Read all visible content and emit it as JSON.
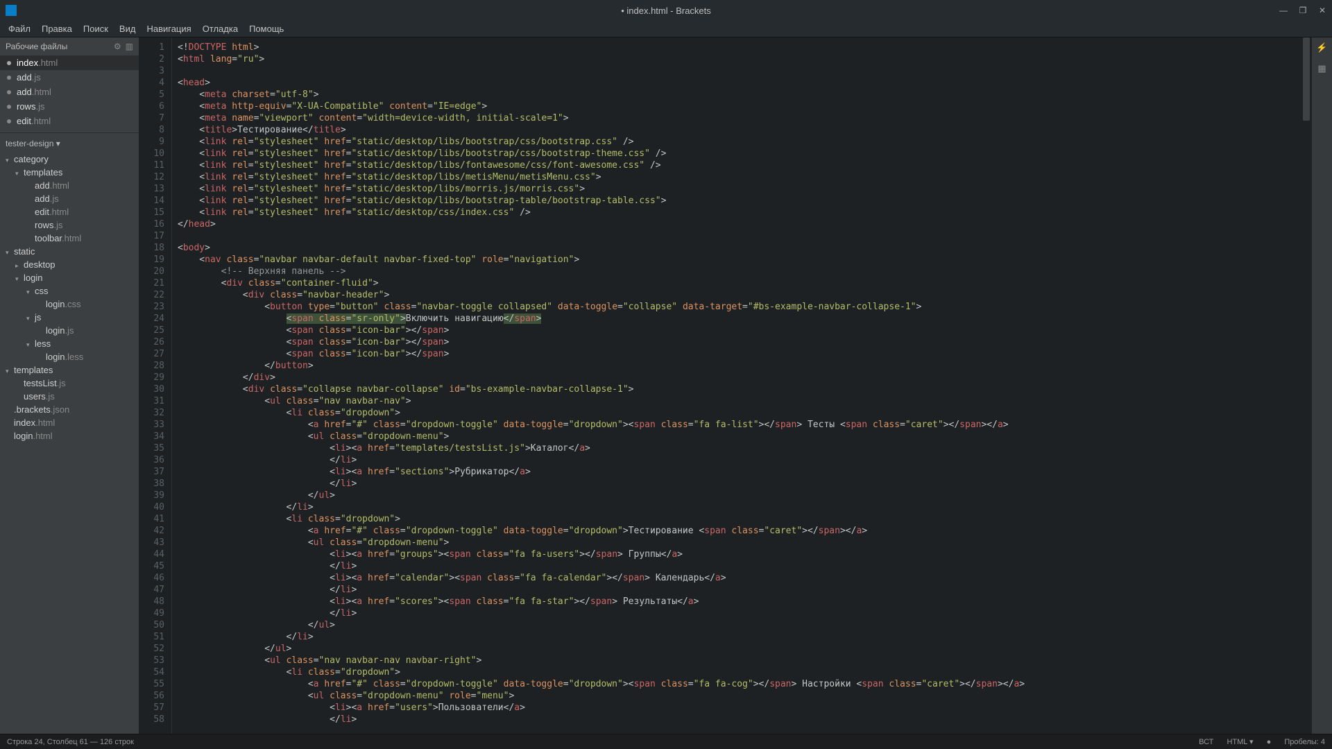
{
  "title": "• index.html - Brackets",
  "menu": [
    "Файл",
    "Правка",
    "Поиск",
    "Вид",
    "Навигация",
    "Отладка",
    "Помощь"
  ],
  "sidebar": {
    "working_files_label": "Рабочие файлы",
    "working_files": [
      {
        "name": "index",
        "ext": ".html",
        "active": true
      },
      {
        "name": "add",
        "ext": ".js"
      },
      {
        "name": "add",
        "ext": ".html"
      },
      {
        "name": "rows",
        "ext": ".js"
      },
      {
        "name": "edit",
        "ext": ".html"
      }
    ],
    "project": "tester-design ▾",
    "tree": [
      {
        "l": 0,
        "arrow": "▾",
        "text": "category"
      },
      {
        "l": 1,
        "arrow": "▾",
        "text": "templates"
      },
      {
        "l": 2,
        "text": "add",
        "ext": ".html"
      },
      {
        "l": 2,
        "text": "add",
        "ext": ".js"
      },
      {
        "l": 2,
        "text": "edit",
        "ext": ".html"
      },
      {
        "l": 2,
        "text": "rows",
        "ext": ".js"
      },
      {
        "l": 2,
        "text": "toolbar",
        "ext": ".html"
      },
      {
        "l": 0,
        "arrow": "▾",
        "text": "static"
      },
      {
        "l": 1,
        "arrow": "▸",
        "text": "desktop"
      },
      {
        "l": 1,
        "arrow": "▾",
        "text": "login"
      },
      {
        "l": 2,
        "arrow": "▾",
        "text": "css"
      },
      {
        "l": 3,
        "text": "login",
        "ext": ".css"
      },
      {
        "l": 2,
        "arrow": "▾",
        "text": "js"
      },
      {
        "l": 3,
        "text": "login",
        "ext": ".js"
      },
      {
        "l": 2,
        "arrow": "▾",
        "text": "less"
      },
      {
        "l": 3,
        "text": "login",
        "ext": ".less"
      },
      {
        "l": 0,
        "arrow": "▾",
        "text": "templates"
      },
      {
        "l": 1,
        "text": "testsList",
        "ext": ".js"
      },
      {
        "l": 1,
        "text": "users",
        "ext": ".js"
      },
      {
        "l": 0,
        "text": ".brackets",
        "ext": ".json"
      },
      {
        "l": 0,
        "text": "index",
        "ext": ".html"
      },
      {
        "l": 0,
        "text": "login",
        "ext": ".html"
      }
    ]
  },
  "status": {
    "left": "Строка 24, Столбец 61 — 126 строк",
    "encoding": "ВСТ",
    "lang": "HTML ▾",
    "lint": "●",
    "spaces": "Пробелы: 4"
  },
  "code_lines": 58
}
